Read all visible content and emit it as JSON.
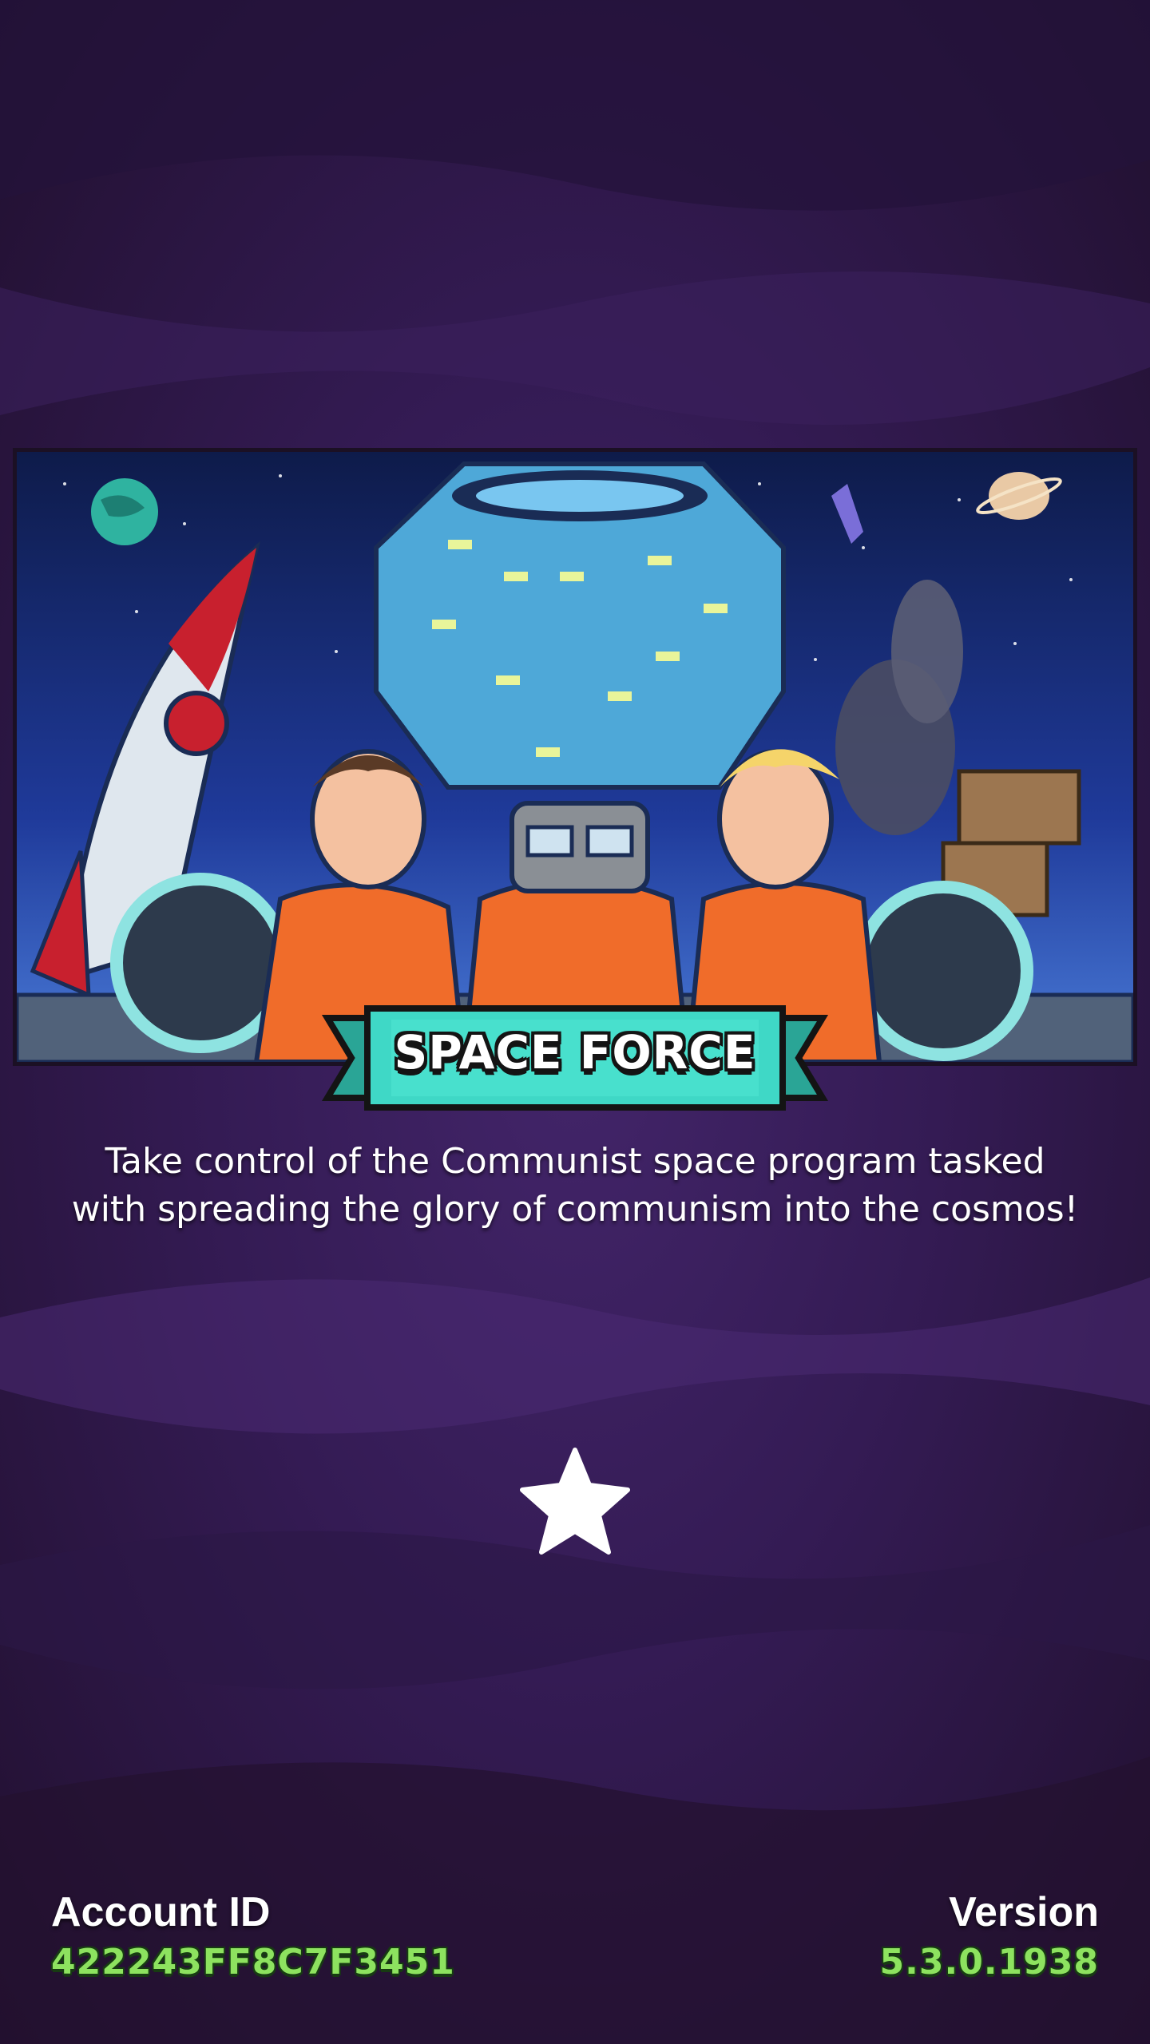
{
  "event": {
    "title": "SPACE FORCE",
    "description_lines": [
      "Take control of the Communist space program tasked",
      "with spreading the glory of communism into the cosmos!"
    ]
  },
  "footer": {
    "account_label": "Account ID",
    "account_id": "422243FF8C7F3451",
    "version_label": "Version",
    "version": "5.3.0.1938"
  },
  "colors": {
    "background": "#341b54",
    "ribbon": "#3fd8c6",
    "account_id_text": "#8de25f",
    "suit_orange": "#f06c2a"
  },
  "icons": {
    "loading": "star-icon"
  }
}
